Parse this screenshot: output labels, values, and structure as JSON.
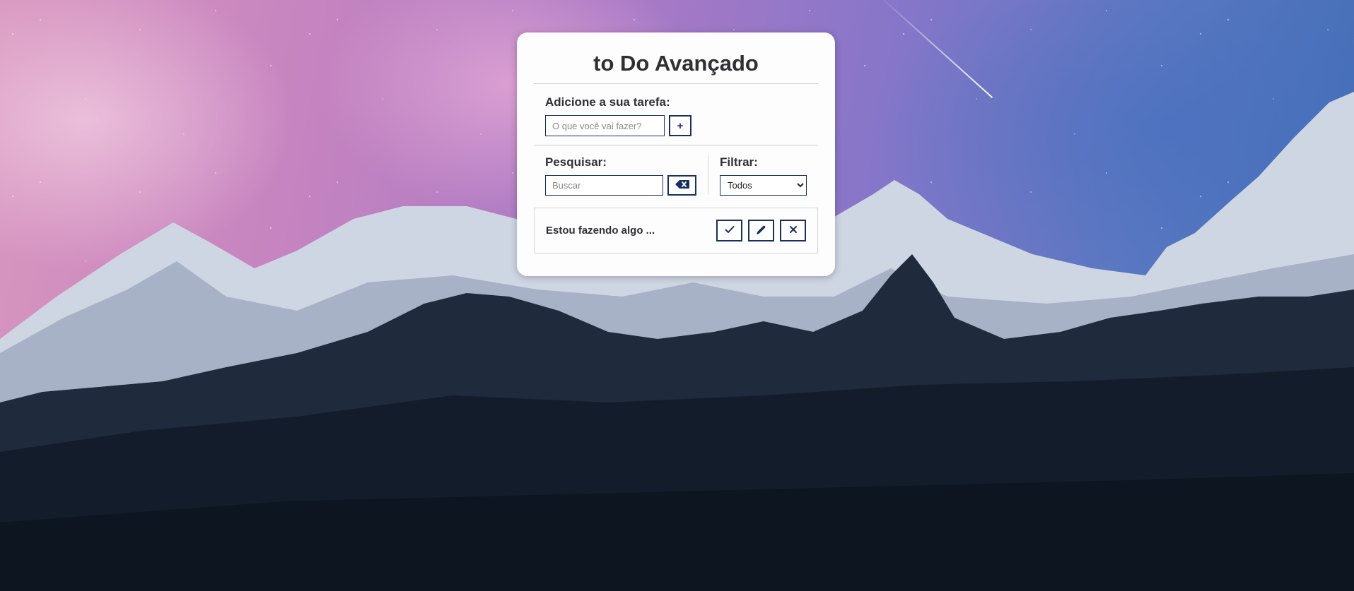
{
  "app": {
    "title": "to Do Avançado"
  },
  "add_task": {
    "label": "Adicione a sua tarefa:",
    "input_placeholder": "O que você vai fazer?",
    "input_value": "",
    "add_button_label": "+"
  },
  "search": {
    "label": "Pesquisar:",
    "input_placeholder": "Buscar",
    "input_value": "",
    "clear_button_icon": "backspace-icon"
  },
  "filter": {
    "label": "Filtrar:",
    "selected": "Todos"
  },
  "todos": [
    {
      "text": "Estou fazendo algo ...",
      "actions": [
        "check-icon",
        "pencil-icon",
        "close-icon"
      ]
    }
  ],
  "colors": {
    "accent": "#17305f",
    "text": "#2f2f35",
    "card_background": "#fdfdfd"
  }
}
